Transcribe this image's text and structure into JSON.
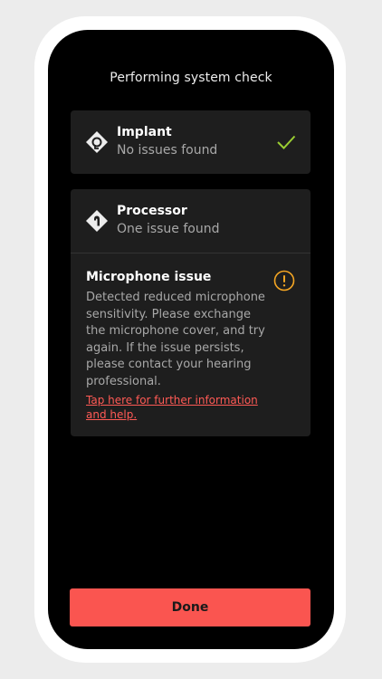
{
  "screen": {
    "title": "Performing system check"
  },
  "devices": [
    {
      "name": "Implant",
      "status": "No issues found",
      "status_icon": "check-icon",
      "icon": "implant-icon"
    },
    {
      "name": "Processor",
      "status": "One issue found",
      "icon": "processor-icon",
      "issue": {
        "title": "Microphone issue",
        "description": "Detected reduced microphone sensitivity. Please exchange the microphone cover, and try again. If the issue persists, please contact your hearing professional.",
        "link_text": "Tap here for further information and help.",
        "icon": "warning-icon"
      }
    }
  ],
  "footer": {
    "done_label": "Done"
  },
  "colors": {
    "background": "#000000",
    "card": "#1e1e1e",
    "accent": "#fa5550",
    "success": "#9acd32",
    "warning": "#f5a623",
    "link": "#ff5a55"
  }
}
